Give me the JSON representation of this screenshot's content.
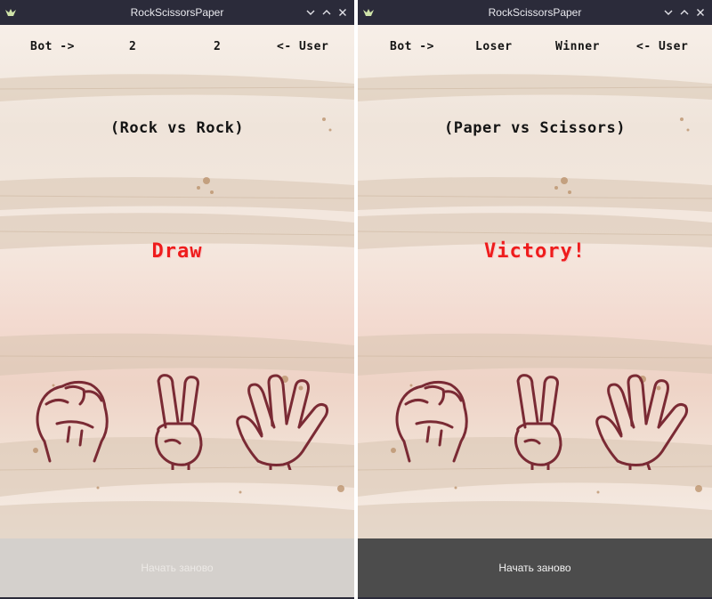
{
  "windows": [
    {
      "title": "RockScissorsPaper",
      "scoreboard": {
        "bot_label": "Bot ->",
        "bot_value": "2",
        "user_value": "2",
        "user_label": "<- User"
      },
      "matchup": "(Rock vs Rock)",
      "result": "Draw",
      "restart_label": "Начать заново",
      "restart_state": "disabled",
      "choices": [
        "rock",
        "scissors",
        "paper"
      ]
    },
    {
      "title": "RockScissorsPaper",
      "scoreboard": {
        "bot_label": "Bot ->",
        "bot_value": "Loser",
        "user_value": "Winner",
        "user_label": "<- User"
      },
      "matchup": "(Paper vs Scissors)",
      "result": "Victory!",
      "restart_label": "Начать заново",
      "restart_state": "enabled",
      "choices": [
        "rock",
        "scissors",
        "paper"
      ]
    }
  ],
  "colors": {
    "titlebar": "#2b2b3a",
    "result_text": "#ee1c1c",
    "hand_stroke": "#7a2a34",
    "restart_enabled_bg": "#4c4c4c",
    "restart_disabled_bg": "#d4d0cc"
  },
  "icons": [
    "app-bird-icon",
    "minimize-icon",
    "maximize-icon",
    "close-icon",
    "fist-icon",
    "victory-hand-icon",
    "open-palm-icon"
  ]
}
